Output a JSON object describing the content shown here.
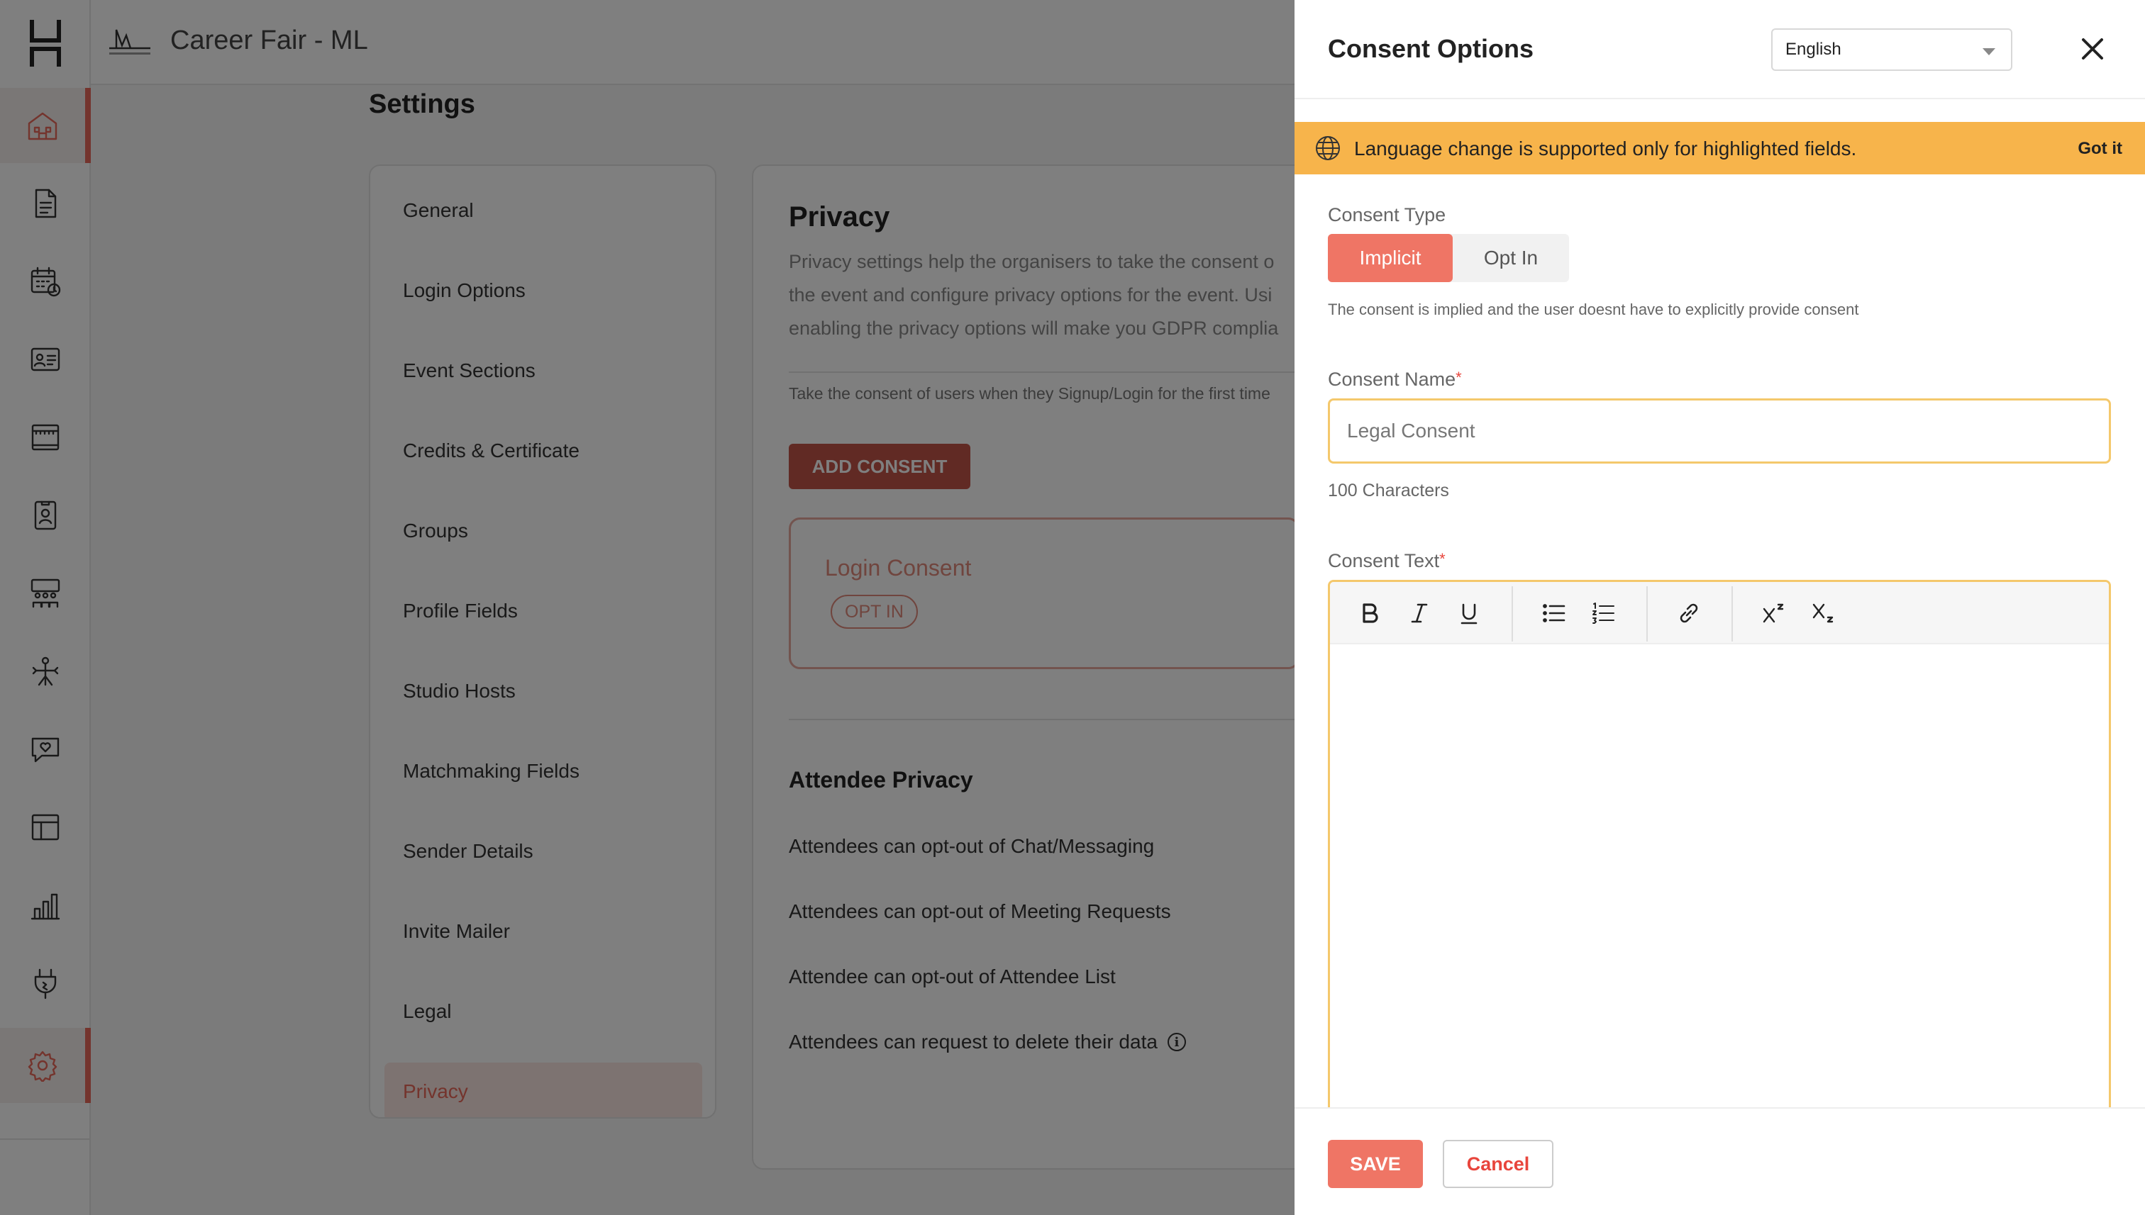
{
  "app": {
    "event_title": "Career Fair - ML",
    "page_title": "Settings"
  },
  "rail": {
    "items": [
      {
        "icon": "building-icon",
        "active": true
      },
      {
        "icon": "document-icon",
        "active": false
      },
      {
        "icon": "calendar-clock-icon",
        "active": false
      },
      {
        "icon": "id-card-icon",
        "active": false
      },
      {
        "icon": "booth-icon",
        "active": false
      },
      {
        "icon": "badge-icon",
        "active": false
      },
      {
        "icon": "lounge-icon",
        "active": false
      },
      {
        "icon": "networking-icon",
        "active": false
      },
      {
        "icon": "chat-heart-icon",
        "active": false
      },
      {
        "icon": "layout-icon",
        "active": false
      },
      {
        "icon": "analytics-icon",
        "active": false
      },
      {
        "icon": "plug-icon",
        "active": false
      },
      {
        "icon": "settings-icon",
        "active": true
      }
    ]
  },
  "settings_nav": {
    "items": [
      "General",
      "Login Options",
      "Event Sections",
      "Credits & Certificate",
      "Groups",
      "Profile Fields",
      "Studio Hosts",
      "Matchmaking Fields",
      "Sender Details",
      "Invite Mailer",
      "Legal",
      "Privacy"
    ],
    "active": "Privacy"
  },
  "privacy": {
    "title": "Privacy",
    "description_lines": [
      "Privacy settings help the organisers to take the consent o",
      "the event and configure privacy options for the event. Usi",
      "enabling the privacy options will make you GDPR complia"
    ],
    "note": "Take the consent of users when they Signup/Login for the first time",
    "add_button": "ADD CONSENT",
    "consent_card": {
      "title": "Login Consent",
      "chip": "OPT IN"
    },
    "attendee_title": "Attendee Privacy",
    "attendee_options": [
      "Attendees can opt-out of Chat/Messaging",
      "Attendees can opt-out of Meeting Requests",
      "Attendee can opt-out of Attendee List",
      "Attendees can request to delete their data"
    ]
  },
  "drawer": {
    "title": "Consent Options",
    "language": "English",
    "banner_text": "Language change is supported only for highlighted fields.",
    "banner_action": "Got it",
    "consent_type_label": "Consent Type",
    "consent_type_options": [
      "Implicit",
      "Opt In"
    ],
    "consent_type_selected": "Implicit",
    "consent_help": "The consent is implied and the user doesnt have to explicitly provide consent",
    "consent_name_label": "Consent Name",
    "consent_name_placeholder": "Legal Consent",
    "consent_name_value": "",
    "char_count": "100 Characters",
    "consent_text_label": "Consent Text",
    "required_mark": "*",
    "toolbar": [
      "bold-icon",
      "italic-icon",
      "underline-icon",
      "bullet-list-icon",
      "numbered-list-icon",
      "link-icon",
      "superscript-icon",
      "subscript-icon"
    ],
    "save_label": "SAVE",
    "cancel_label": "Cancel"
  },
  "colors": {
    "accent": "#ef7565",
    "accent_dark": "#c35548",
    "banner": "#f7b44b",
    "focus_border": "#f4c86c"
  }
}
